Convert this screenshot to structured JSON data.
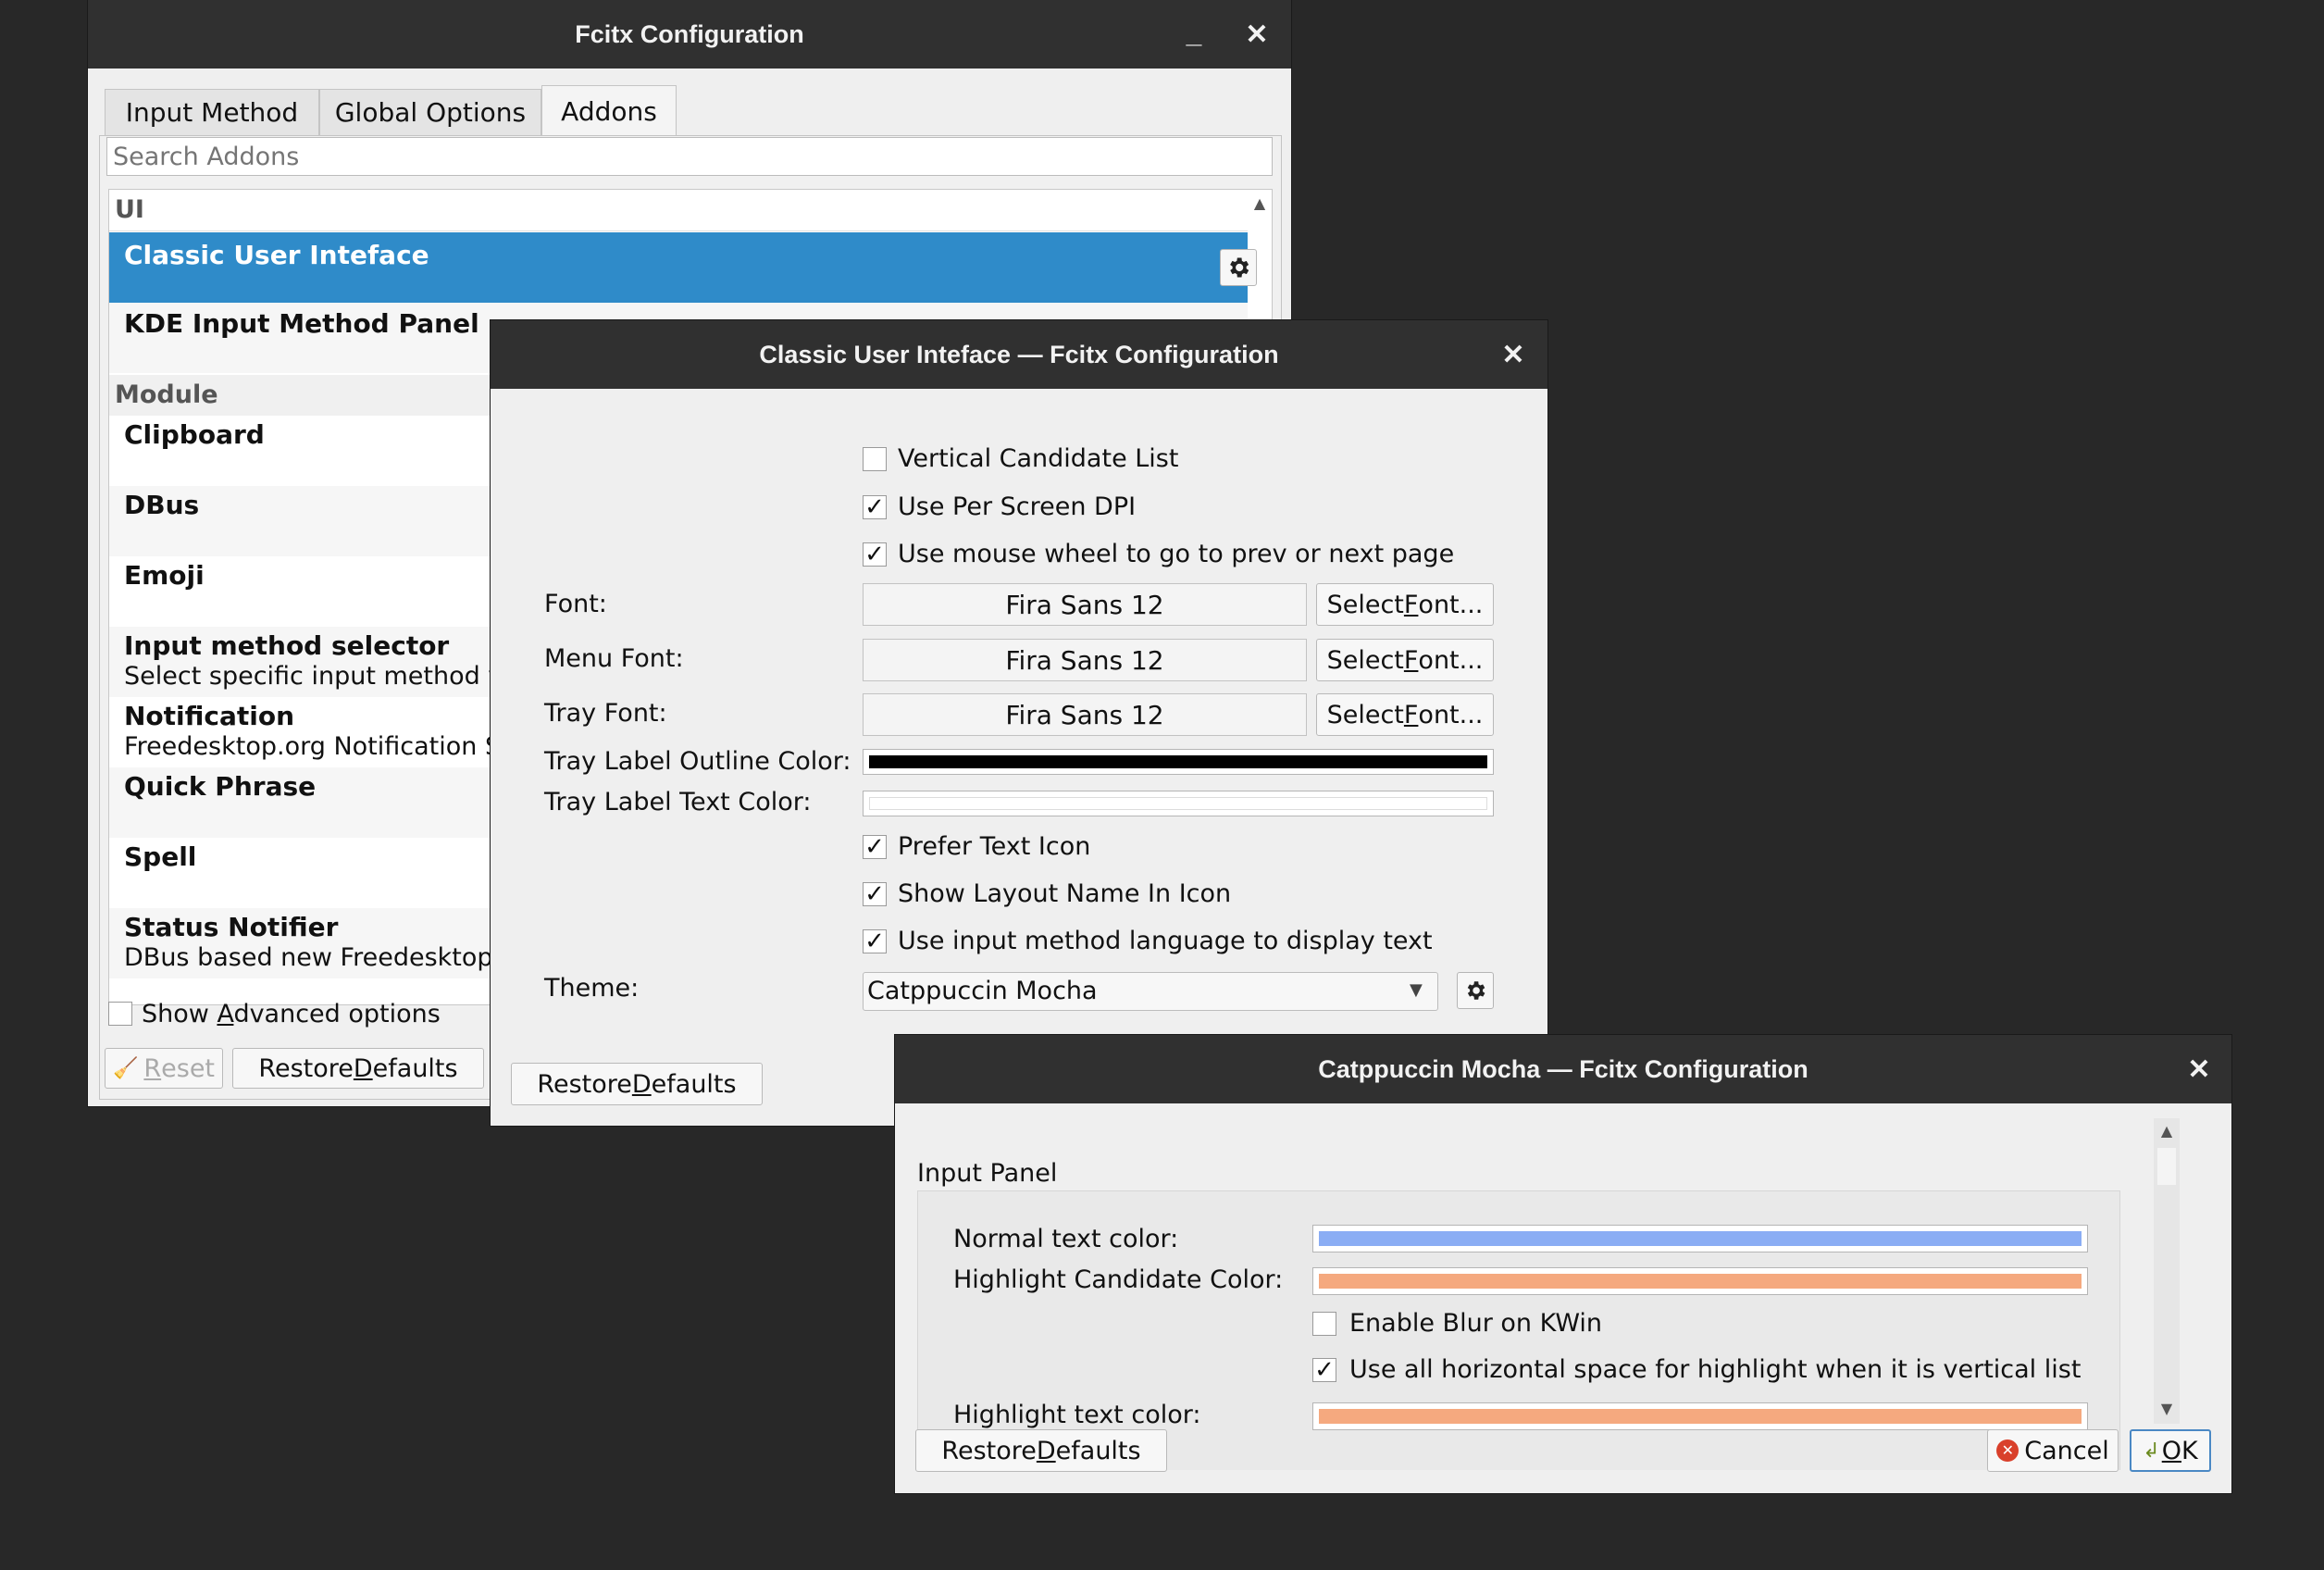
{
  "main": {
    "title": "Fcitx Configuration",
    "tabs": [
      "Input Method",
      "Global Options",
      "Addons"
    ],
    "search_placeholder": "Search Addons",
    "categories": {
      "ui": "UI",
      "module": "Module"
    },
    "items": [
      {
        "title": "Classic User Inteface",
        "desc": ""
      },
      {
        "title": "KDE Input Method Panel",
        "desc": ""
      },
      {
        "title": "Clipboard",
        "desc": ""
      },
      {
        "title": "DBus",
        "desc": ""
      },
      {
        "title": "Emoji",
        "desc": ""
      },
      {
        "title": "Input method selector",
        "desc": "Select specific input method v"
      },
      {
        "title": "Notification",
        "desc": "Freedesktop.org Notification S"
      },
      {
        "title": "Quick Phrase",
        "desc": ""
      },
      {
        "title": "Spell",
        "desc": ""
      },
      {
        "title": "Status Notifier",
        "desc": "DBus based new Freedesktop."
      }
    ],
    "advanced_pre": "Show ",
    "advanced_key": "A",
    "advanced_post": "dvanced options",
    "reset_key": "R",
    "reset_post": "eset",
    "restore_pre": "Restore ",
    "restore_key": "D",
    "restore_post": "efaults"
  },
  "classic": {
    "title": "Classic User Inteface — Fcitx Configuration",
    "checks": [
      {
        "label": "Vertical Candidate List",
        "checked": false
      },
      {
        "label": "Use Per Screen DPI",
        "checked": true
      },
      {
        "label": "Use mouse wheel to go to prev or next page",
        "checked": true
      }
    ],
    "font_label": "Font:",
    "menu_font_label": "Menu Font:",
    "tray_font_label": "Tray Font:",
    "font_value": "Fira Sans 12",
    "menu_font_value": "Fira Sans 12",
    "tray_font_value": "Fira Sans 12",
    "select_pre": "Select ",
    "select_key": "F",
    "select_post": "ont...",
    "outline_label": "Tray Label Outline Color:",
    "text_color_label": "Tray Label Text Color:",
    "outline_color": "#000000",
    "text_color": "#ffffff",
    "checks2": [
      {
        "label": "Prefer Text Icon",
        "checked": true
      },
      {
        "label": "Show Layout Name In Icon",
        "checked": true
      },
      {
        "label": "Use input method language to display text",
        "checked": true
      }
    ],
    "theme_label": "Theme:",
    "theme_value": "Catppuccin Mocha",
    "check_mark": "✓"
  },
  "theme": {
    "title": "Catppuccin Mocha — Fcitx Configuration",
    "group": "Input Panel",
    "normal_label": "Normal text color:",
    "normal_color": "#8aadf4",
    "highlight_label": "Highlight Candidate Color:",
    "highlight_color": "#f5a97f",
    "blur_label": "Enable Blur on KWin",
    "blur_checked": false,
    "hspace_label": "Use all horizontal space for highlight when it is vertical list",
    "hspace_checked": true,
    "hl_text_label": "Highlight text color:",
    "hl_text_color": "#f5a97f",
    "cancel": "Cancel",
    "ok_key": "O",
    "ok_post": "K"
  },
  "icons": [
    "gear-icon",
    "close-icon",
    "minimize-icon",
    "broom-icon",
    "cancel-icon",
    "ok-icon",
    "chevron-down-icon",
    "scroll-up-icon",
    "scroll-down-icon"
  ]
}
